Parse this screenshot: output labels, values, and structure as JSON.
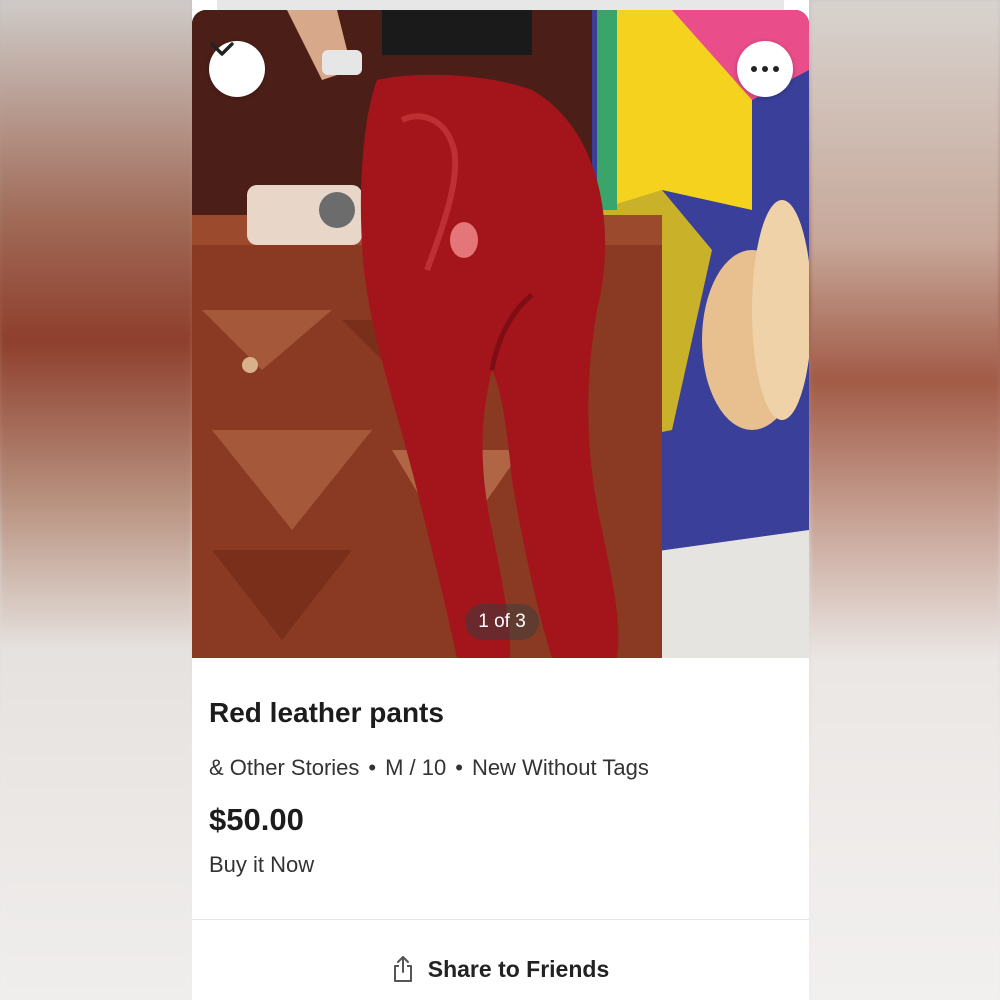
{
  "listing": {
    "title": "Red leather pants",
    "brand": "& Other Stories",
    "size": "M / 10",
    "condition": "New Without Tags",
    "separator": "•",
    "price": "$50.00",
    "buy_label": "Buy it Now"
  },
  "gallery": {
    "counter": "1 of 3",
    "current": 1,
    "total": 3
  },
  "actions": {
    "share_label": "Share to Friends"
  },
  "icons": {
    "collapse": "chevron-down-icon",
    "more": "more-dots-icon",
    "share": "share-icon"
  },
  "colors": {
    "pants": "#a3141b",
    "dresser": "#8a3a22",
    "text": "#1c1c1c"
  }
}
